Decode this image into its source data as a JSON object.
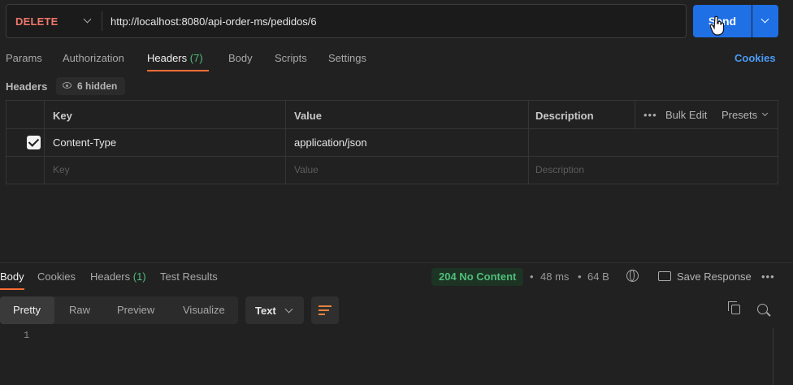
{
  "request": {
    "method": "DELETE",
    "url": "http://localhost:8080/api-order-ms/pedidos/6",
    "send_label": "Send"
  },
  "request_tabs": [
    {
      "label": "Params"
    },
    {
      "label": "Authorization"
    },
    {
      "label": "Headers",
      "count": "(7)",
      "active": true
    },
    {
      "label": "Body"
    },
    {
      "label": "Scripts"
    },
    {
      "label": "Settings"
    }
  ],
  "cookies_link": "Cookies",
  "headers_section": {
    "title": "Headers",
    "hidden_label": "6 hidden",
    "columns": {
      "key": "Key",
      "value": "Value",
      "description": "Description"
    },
    "bulk_edit": "Bulk Edit",
    "presets": "Presets",
    "rows": [
      {
        "checked": true,
        "key": "Content-Type",
        "value": "application/json",
        "description": ""
      }
    ],
    "placeholders": {
      "key": "Key",
      "value": "Value",
      "description": "Description"
    }
  },
  "response_tabs": [
    {
      "label": "Body",
      "active": true
    },
    {
      "label": "Cookies"
    },
    {
      "label": "Headers",
      "count": "(1)"
    },
    {
      "label": "Test Results"
    }
  ],
  "response_meta": {
    "status": "204 No Content",
    "time": "48 ms",
    "size": "64 B",
    "save_response": "Save Response"
  },
  "view_modes": [
    "Pretty",
    "Raw",
    "Preview",
    "Visualize"
  ],
  "active_view_mode": "Pretty",
  "format": "Text",
  "body_lines": [
    "1"
  ],
  "colors": {
    "method": "#f0776b",
    "accent": "#ff6c37",
    "send": "#1f6fe5",
    "status_ok": "#4fbe79",
    "link": "#4a9af5"
  }
}
